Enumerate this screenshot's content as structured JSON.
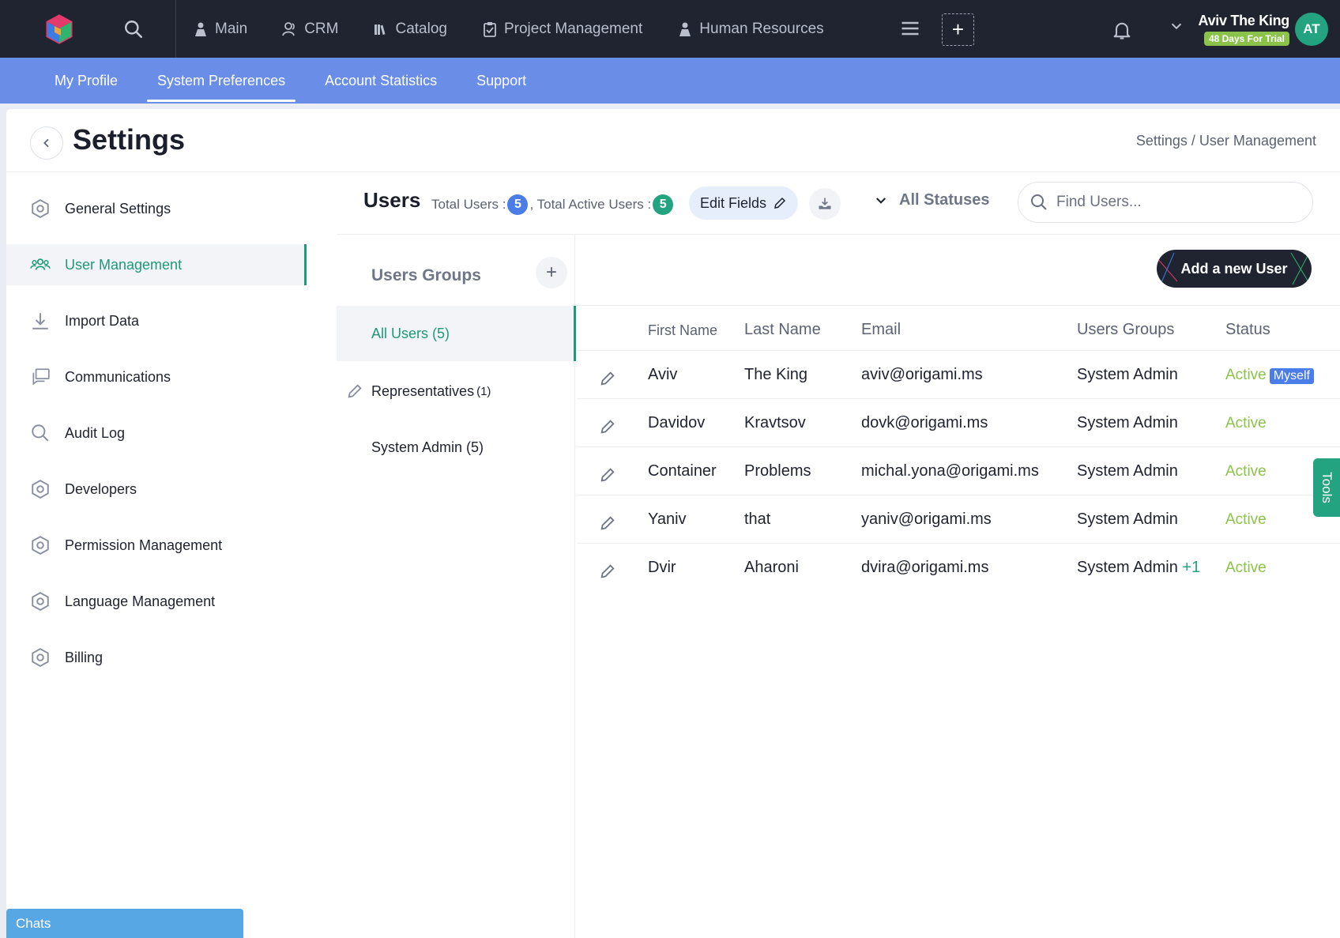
{
  "topnav": {
    "items": [
      {
        "label": "Main",
        "icon": "person-icon"
      },
      {
        "label": "CRM",
        "icon": "contacts-icon"
      },
      {
        "label": "Catalog",
        "icon": "books-icon"
      },
      {
        "label": "Project Management",
        "icon": "clipboard-check-icon"
      },
      {
        "label": "Human Resources",
        "icon": "person-icon"
      }
    ],
    "add_label": "+",
    "user_name": "Aviv The King",
    "trial_label": "48 Days For Trial",
    "avatar_initials": "AT"
  },
  "subnav": {
    "items": [
      {
        "label": "My Profile"
      },
      {
        "label": "System Preferences"
      },
      {
        "label": "Account Statistics"
      },
      {
        "label": "Support"
      }
    ],
    "active_index": 1
  },
  "page": {
    "title": "Settings",
    "breadcrumb": "Settings / User Management"
  },
  "left_menu": {
    "items": [
      {
        "label": "General Settings",
        "icon": "settings-gear-icon"
      },
      {
        "label": "User Management",
        "icon": "users-group-icon"
      },
      {
        "label": "Import Data",
        "icon": "download-icon"
      },
      {
        "label": "Communications",
        "icon": "chat-bubbles-icon"
      },
      {
        "label": "Audit Log",
        "icon": "search-icon"
      },
      {
        "label": "Developers",
        "icon": "settings-gear-icon"
      },
      {
        "label": "Permission Management",
        "icon": "settings-gear-icon"
      },
      {
        "label": "Language Management",
        "icon": "settings-gear-icon"
      },
      {
        "label": "Billing",
        "icon": "settings-gear-icon"
      }
    ],
    "active_index": 1
  },
  "users": {
    "title": "Users",
    "total_label": "Total Users :",
    "total_count": "5",
    "active_label": ", Total Active Users :",
    "active_count": "5",
    "edit_fields_label": "Edit Fields",
    "status_filter": "All Statuses",
    "search_placeholder": "Find Users...",
    "add_user_label": "Add a new User"
  },
  "groups": {
    "title": "Users Groups",
    "items": [
      {
        "label": "All Users (5)"
      },
      {
        "label": "Representatives",
        "sup": "(1)"
      },
      {
        "label": "System Admin (5)"
      }
    ]
  },
  "table": {
    "headers": {
      "first": "First Name",
      "last": "Last Name",
      "email": "Email",
      "groups": "Users Groups",
      "status": "Status"
    },
    "rows": [
      {
        "first": "Aviv",
        "last": "The King",
        "email": "aviv@origami.ms",
        "groups": "System Admin",
        "extra": "",
        "status": "Active",
        "badge": "Myself"
      },
      {
        "first": "Davidov",
        "last": "Kravtsov",
        "email": "dovk@origami.ms",
        "groups": "System Admin",
        "extra": "",
        "status": "Active",
        "badge": ""
      },
      {
        "first": "Container",
        "last": "Problems",
        "email": "michal.yona@origami.ms",
        "groups": "System Admin",
        "extra": "",
        "status": "Active",
        "badge": ""
      },
      {
        "first": "Yaniv",
        "last": "that",
        "email": "yaniv@origami.ms",
        "groups": "System Admin",
        "extra": "",
        "status": "Active",
        "badge": ""
      },
      {
        "first": "Dvir",
        "last": "Aharoni",
        "email": "dvira@origami.ms",
        "groups": "System Admin",
        "extra": "+1",
        "status": "Active",
        "badge": ""
      }
    ]
  },
  "tools_label": "Tools",
  "chats_label": "Chats",
  "colors": {
    "accent": "#1e9a78",
    "subnav": "#6a8ee8",
    "topbar": "#1f2430",
    "active_status": "#8bc34a"
  }
}
